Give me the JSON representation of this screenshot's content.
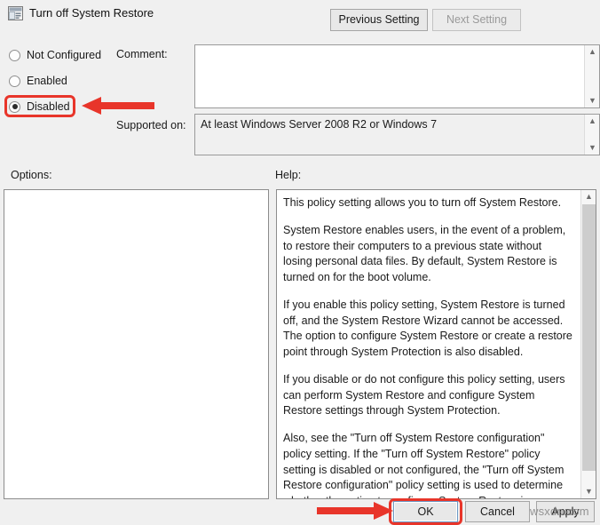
{
  "window": {
    "title": "Turn off System Restore",
    "icon": "group-policy-setting-icon"
  },
  "navigation": {
    "previous_setting": "Previous Setting",
    "next_setting": "Next Setting",
    "next_setting_enabled": false
  },
  "state_options": [
    {
      "label": "Not Configured",
      "selected": false
    },
    {
      "label": "Enabled",
      "selected": false
    },
    {
      "label": "Disabled",
      "selected": true
    }
  ],
  "fields": {
    "comment_label": "Comment:",
    "comment_value": "",
    "supported_label": "Supported on:",
    "supported_value": "At least Windows Server 2008 R2 or Windows 7"
  },
  "panels": {
    "options_label": "Options:",
    "options_content": "",
    "help_label": "Help:",
    "help_paragraphs": [
      "This policy setting allows you to turn off System Restore.",
      "System Restore enables users, in the event of a problem, to restore their computers to a previous state without losing personal data files. By default, System Restore is turned on for the boot volume.",
      "If you enable this policy setting, System Restore is turned off, and the System Restore Wizard cannot be accessed. The option to configure System Restore or create a restore point through System Protection is also disabled.",
      "If you disable or do not configure this policy setting, users can perform System Restore and configure System Restore settings through System Protection.",
      "Also, see the \"Turn off System Restore configuration\" policy setting. If the \"Turn off System Restore\" policy setting is disabled or not configured, the \"Turn off System Restore configuration\" policy setting is used to determine whether the option to configure System Restore is available."
    ]
  },
  "dialog_buttons": {
    "ok": "OK",
    "cancel": "Cancel",
    "apply": "Apply"
  },
  "annotations": {
    "color": "#e8352a",
    "highlighted_radio": "Disabled",
    "highlighted_button": "OK"
  },
  "watermark": "wsxdn.com"
}
